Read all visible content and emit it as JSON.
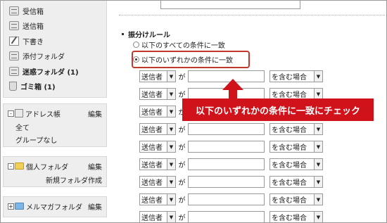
{
  "sidebar": {
    "folders": [
      {
        "label": "受信箱",
        "icon": "inbox-icon",
        "bold": false
      },
      {
        "label": "送信箱",
        "icon": "outbox-icon",
        "bold": false
      },
      {
        "label": "下書き",
        "icon": "draft-icon",
        "bold": false
      },
      {
        "label": "添付フォルダ",
        "icon": "attachment-folder-icon",
        "bold": false
      },
      {
        "label": "迷惑フォルダ (1)",
        "icon": "spam-folder-icon",
        "bold": true
      },
      {
        "label": "ゴミ箱 (1)",
        "icon": "trash-icon",
        "bold": true
      }
    ],
    "address_book": {
      "toggle": "-",
      "title": "アドレス帳",
      "edit": "編集",
      "items": [
        "全て",
        "グループなし"
      ]
    },
    "personal_folder": {
      "toggle": "-",
      "title": "個人フォルダ",
      "edit": "編集",
      "items": [
        "新規フォルダ作成"
      ]
    },
    "mailmag_folder": {
      "toggle": "+",
      "title": "メルマガフォルダ",
      "edit": "編集"
    }
  },
  "rules": {
    "section_title": "振分けルール",
    "options": [
      {
        "label": "以下のすべての条件に一致",
        "selected": false
      },
      {
        "label": "以下のいずれかの条件に一致",
        "selected": true
      }
    ],
    "rows": [
      {
        "field": "送信者",
        "ga": "が",
        "condition": "を含む場合"
      },
      {
        "field": "送信者",
        "ga": "が",
        "condition": "を含む場合"
      },
      {
        "field": "送信者",
        "ga": "が",
        "condition": "を含む場合"
      },
      {
        "field": "送信者",
        "ga": "が",
        "condition": "を含む場合"
      },
      {
        "field": "送信者",
        "ga": "が",
        "condition": "を含む場合"
      },
      {
        "field": "送信者",
        "ga": "が",
        "condition": "を含む場合"
      },
      {
        "field": "送信者",
        "ga": "が",
        "condition": "を含む場合"
      },
      {
        "field": "送信者",
        "ga": "が",
        "condition": "を含む場合"
      },
      {
        "field": "送信者",
        "ga": "が",
        "condition": "を含む場合"
      }
    ],
    "dropdown_arrow": "▼"
  },
  "callout": {
    "text": "以下のいずれかの条件に一致にチェック",
    "color": "#d0121b"
  },
  "colors": {
    "highlight": "#c0392b",
    "panel_bg": "#eeeeee"
  }
}
